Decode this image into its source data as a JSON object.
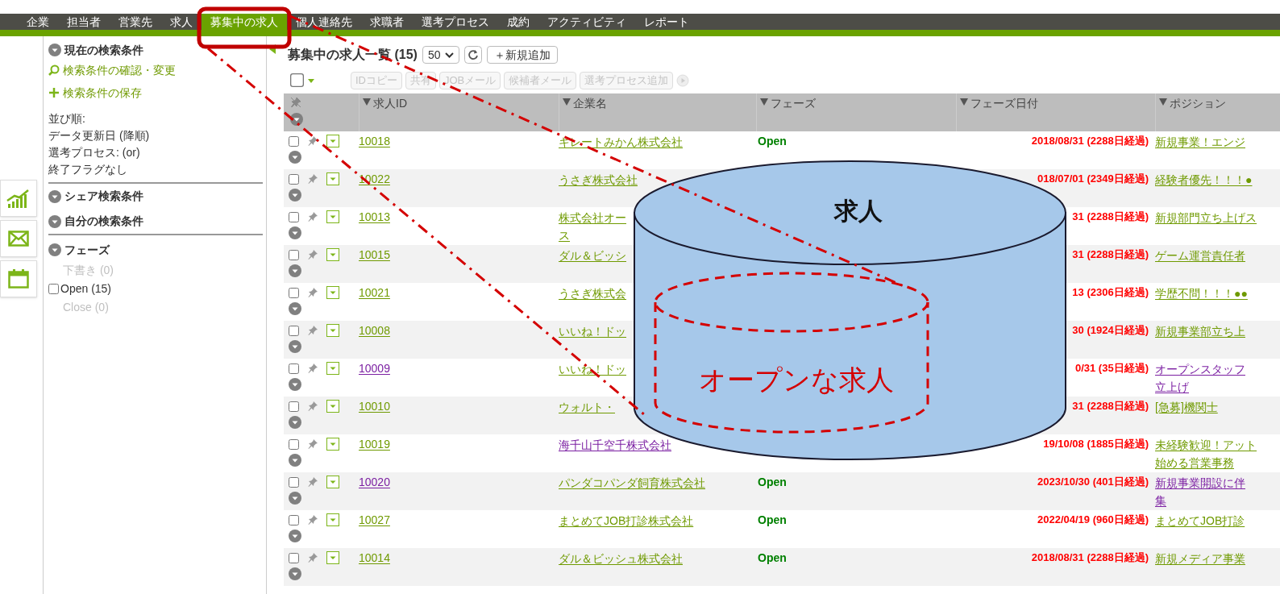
{
  "nav": {
    "tabs": [
      {
        "label": "企業",
        "selected": false
      },
      {
        "label": "担当者",
        "selected": false
      },
      {
        "label": "営業先",
        "selected": false
      },
      {
        "label": "求人",
        "selected": false
      },
      {
        "label": "募集中の求人",
        "selected": true
      },
      {
        "label": "個人連絡先",
        "selected": false
      },
      {
        "label": "求職者",
        "selected": false
      },
      {
        "label": "選考プロセス",
        "selected": false
      },
      {
        "label": "成約",
        "selected": false
      },
      {
        "label": "アクティビティ",
        "selected": false
      },
      {
        "label": "レポート",
        "selected": false
      }
    ]
  },
  "sidebar": {
    "current_title": "現在の検索条件",
    "links": [
      {
        "kind": "search",
        "label": "検索条件の確認・変更"
      },
      {
        "kind": "add",
        "label": "検索条件の保存"
      }
    ],
    "conditions": [
      "並び順:",
      "データ更新日 (降順)",
      "選考プロセス: (or)",
      "終了フラグなし"
    ],
    "sections": [
      "シェア検索条件",
      "自分の検索条件"
    ],
    "phase_title": "フェーズ",
    "phase_options": [
      {
        "label": "下書き (0)",
        "disabled": true
      },
      {
        "label": "Open (15)",
        "disabled": false,
        "checked": false
      },
      {
        "label": "Close (0)",
        "disabled": true
      }
    ]
  },
  "main": {
    "title": "募集中の求人一覧 (15)",
    "page_size": "50",
    "select_all_checked": false,
    "add_button": "＋新規追加",
    "actions": [
      "IDコピー",
      "共有",
      "JOBメール",
      "候補者メール",
      "選考プロセス追加"
    ],
    "columns": [
      "求人ID",
      "企業名",
      "フェーズ",
      "フェーズ日付",
      "ポジション"
    ],
    "rows": [
      {
        "checked": false,
        "id": "10018",
        "id_visited": false,
        "company": [
          "キレートみかん株式会社"
        ],
        "company_visited": false,
        "phase": "Open",
        "date": "2018/08/31 (2288日経過)",
        "position": [
          "新規事業！エンジ"
        ],
        "position_visited": false
      },
      {
        "checked": false,
        "id": "10022",
        "id_visited": false,
        "company": [
          "うさぎ株式会社"
        ],
        "company_visited": false,
        "date": "018/07/01 (2349日経過)",
        "position": [
          "経験者優先！！！●"
        ],
        "position_visited": false
      },
      {
        "checked": false,
        "id": "10013",
        "id_visited": false,
        "company": [
          "株式会社オー",
          "ス"
        ],
        "company_visited": false,
        "date": "31 (2288日経過)",
        "position": [
          "新規部門立ち上げス"
        ],
        "position_visited": false
      },
      {
        "checked": false,
        "id": "10015",
        "id_visited": false,
        "company": [
          "ダル＆ビッシ"
        ],
        "company_visited": false,
        "date": "31 (2288日経過)",
        "position": [
          "ゲーム運営責任者"
        ],
        "position_visited": false
      },
      {
        "checked": false,
        "id": "10021",
        "id_visited": false,
        "company": [
          "うさぎ株式会"
        ],
        "company_visited": false,
        "date": "13 (2306日経過)",
        "position": [
          "学歴不問！！！●●"
        ],
        "position_visited": false
      },
      {
        "checked": false,
        "id": "10008",
        "id_visited": false,
        "company": [
          "いいね！ドッ"
        ],
        "company_visited": false,
        "date": "30 (1924日経過)",
        "position": [
          "新規事業部立ち上"
        ],
        "position_visited": false
      },
      {
        "checked": false,
        "id": "10009",
        "id_visited": true,
        "company": [
          "いいね！ドッ"
        ],
        "company_visited": false,
        "date": "0/31 (35日経過)",
        "position": [
          "オープンスタッフ",
          "立上げ"
        ],
        "position_visited": true
      },
      {
        "checked": false,
        "id": "10010",
        "id_visited": false,
        "company": [
          "ウォルト・"
        ],
        "company_visited": false,
        "date": "31 (2288日経過)",
        "position": [
          "[急募]機関士"
        ],
        "position_visited": false
      },
      {
        "checked": false,
        "id": "10019",
        "id_visited": false,
        "company": [
          "海千山千空千株式会社"
        ],
        "company_visited": true,
        "date": "19/10/08 (1885日経過)",
        "position": [
          "未経験歓迎！アット",
          "始める営業事務"
        ],
        "position_visited": false
      },
      {
        "checked": false,
        "id": "10020",
        "id_visited": true,
        "company": [
          "パンダコパンダ飼育株式会社"
        ],
        "company_visited": false,
        "phase": "Open",
        "date": "2023/10/30 (401日経過)",
        "position": [
          "新規事業開設に伴",
          "集"
        ],
        "position_visited": true
      },
      {
        "checked": false,
        "id": "10027",
        "id_visited": false,
        "company": [
          "まとめてJOB打診株式会社"
        ],
        "company_visited": false,
        "phase": "Open",
        "date": "2022/04/19 (960日経過)",
        "position": [
          "まとめてJOB打診"
        ],
        "position_visited": false
      },
      {
        "checked": false,
        "id": "10014",
        "id_visited": false,
        "company": [
          "ダル＆ビッシュ株式会社"
        ],
        "company_visited": false,
        "phase": "Open",
        "date": "2018/08/31 (2288日経過)",
        "position": [
          "新規メディア事業"
        ],
        "position_visited": false
      }
    ]
  },
  "annotation": {
    "outer_label": "求人",
    "inner_label": "オープンな求人"
  }
}
